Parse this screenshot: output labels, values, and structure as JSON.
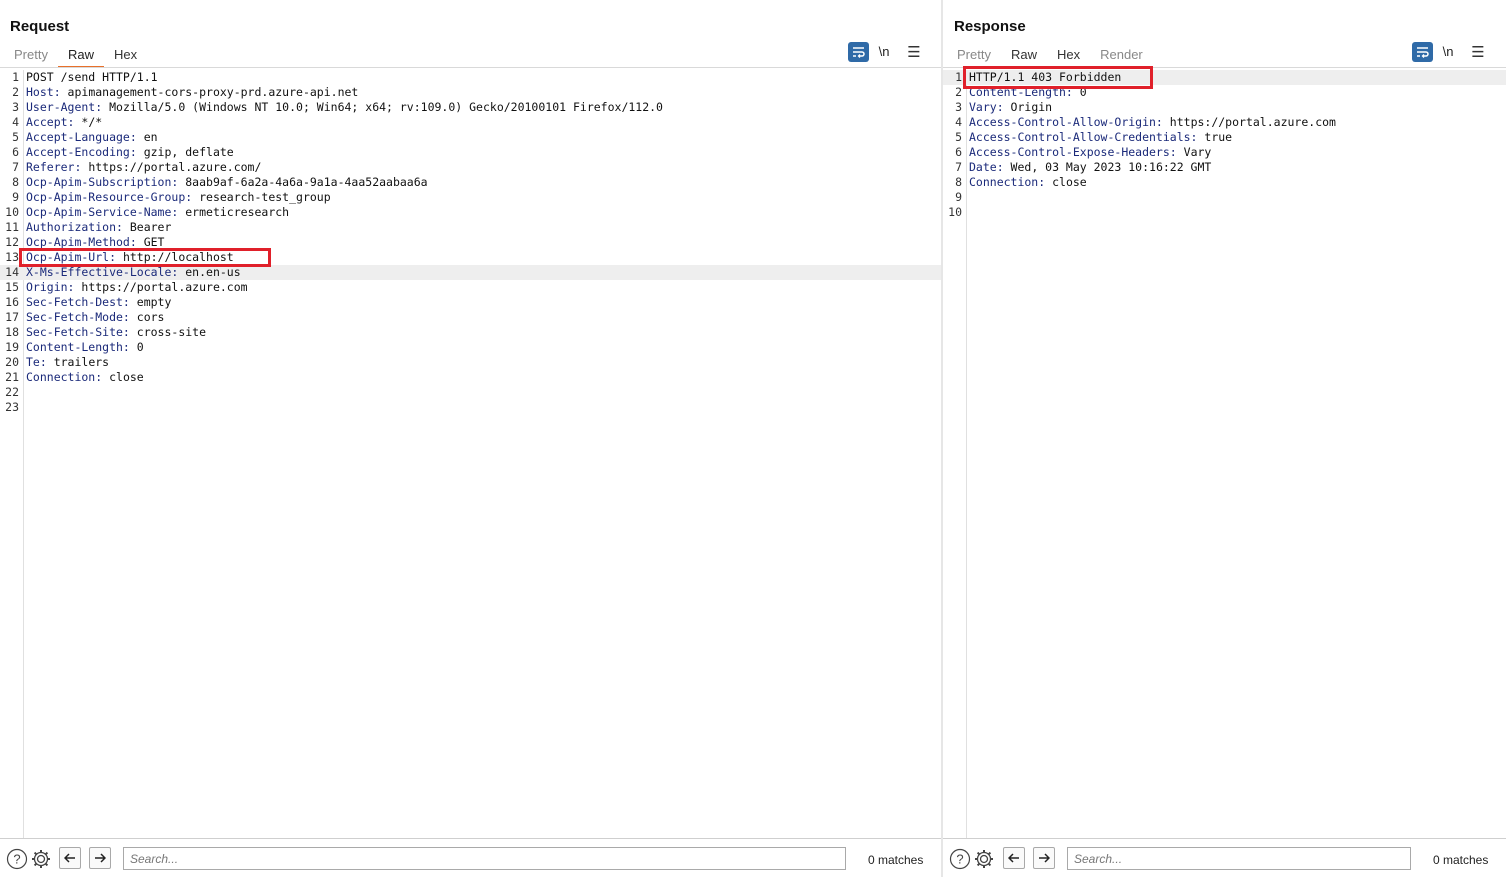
{
  "request": {
    "title": "Request",
    "tabs": [
      {
        "label": "Pretty",
        "state": "inactive"
      },
      {
        "label": "Raw",
        "state": "active"
      },
      {
        "label": "Hex",
        "state": "normal"
      }
    ],
    "newline_label": "\\n",
    "lines": [
      {
        "n": "1",
        "key": "",
        "val": "POST /send HTTP/1.1"
      },
      {
        "n": "2",
        "key": "Host:",
        "val": " apimanagement-cors-proxy-prd.azure-api.net"
      },
      {
        "n": "3",
        "key": "User-Agent:",
        "val": " Mozilla/5.0 (Windows NT 10.0; Win64; x64; rv:109.0) Gecko/20100101 Firefox/112.0"
      },
      {
        "n": "4",
        "key": "Accept:",
        "val": " */*"
      },
      {
        "n": "5",
        "key": "Accept-Language:",
        "val": " en"
      },
      {
        "n": "6",
        "key": "Accept-Encoding:",
        "val": " gzip, deflate"
      },
      {
        "n": "7",
        "key": "Referer:",
        "val": " https://portal.azure.com/"
      },
      {
        "n": "8",
        "key": "Ocp-Apim-Subscription:",
        "val": " 8aab9af-6a2a-4a6a-9a1a-4aa52aabaa6a"
      },
      {
        "n": "9",
        "key": "Ocp-Apim-Resource-Group:",
        "val": " research-test_group"
      },
      {
        "n": "10",
        "key": "Ocp-Apim-Service-Name:",
        "val": " ermeticresearch"
      },
      {
        "n": "11",
        "key": "Authorization:",
        "val": " Bearer"
      },
      {
        "n": "12",
        "key": "Ocp-Apim-Method:",
        "val": " GET"
      },
      {
        "n": "13",
        "key": "Ocp-Apim-Url:",
        "val": " http://localhost"
      },
      {
        "n": "14",
        "key": "X-Ms-Effective-Locale:",
        "val": " en.en-us"
      },
      {
        "n": "15",
        "key": "Origin:",
        "val": " https://portal.azure.com"
      },
      {
        "n": "16",
        "key": "Sec-Fetch-Dest:",
        "val": " empty"
      },
      {
        "n": "17",
        "key": "Sec-Fetch-Mode:",
        "val": " cors"
      },
      {
        "n": "18",
        "key": "Sec-Fetch-Site:",
        "val": " cross-site"
      },
      {
        "n": "19",
        "key": "Content-Length:",
        "val": " 0"
      },
      {
        "n": "20",
        "key": "Te:",
        "val": " trailers"
      },
      {
        "n": "21",
        "key": "Connection:",
        "val": " close"
      },
      {
        "n": "22",
        "key": "",
        "val": ""
      },
      {
        "n": "23",
        "key": "",
        "val": ""
      }
    ],
    "search_placeholder": "Search...",
    "matches": "0 matches"
  },
  "response": {
    "title": "Response",
    "tabs": [
      {
        "label": "Pretty",
        "state": "inactive"
      },
      {
        "label": "Raw",
        "state": "normal"
      },
      {
        "label": "Hex",
        "state": "normal"
      },
      {
        "label": "Render",
        "state": "inactive"
      }
    ],
    "newline_label": "\\n",
    "lines": [
      {
        "n": "1",
        "key": "",
        "val": "HTTP/1.1 403 Forbidden"
      },
      {
        "n": "2",
        "key": "Content-Length:",
        "val": " 0"
      },
      {
        "n": "3",
        "key": "Vary:",
        "val": " Origin"
      },
      {
        "n": "4",
        "key": "Access-Control-Allow-Origin:",
        "val": " https://portal.azure.com"
      },
      {
        "n": "5",
        "key": "Access-Control-Allow-Credentials:",
        "val": " true"
      },
      {
        "n": "6",
        "key": "Access-Control-Expose-Headers:",
        "val": " Vary"
      },
      {
        "n": "7",
        "key": "Date:",
        "val": " Wed, 03 May 2023 10:16:22 GMT"
      },
      {
        "n": "8",
        "key": "Connection:",
        "val": " close"
      },
      {
        "n": "9",
        "key": "",
        "val": ""
      },
      {
        "n": "10",
        "key": "",
        "val": ""
      }
    ],
    "search_placeholder": "Search...",
    "matches": "0 matches"
  },
  "colors": {
    "accent": "#2f6aa7",
    "highlight_box": "#e0202a",
    "tab_underline": "#e8702a",
    "header_key": "#1b2a7a"
  }
}
